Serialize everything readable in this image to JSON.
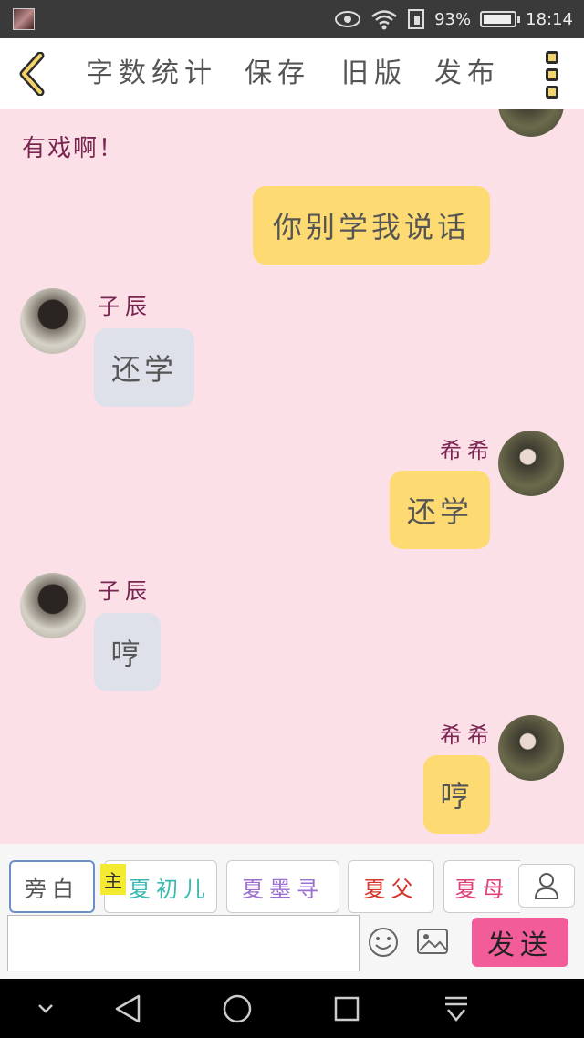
{
  "status_bar": {
    "battery": "93%",
    "time": "18:14",
    "battery_level": 0.93
  },
  "toolbar": {
    "items": [
      "字数统计",
      "保存",
      "旧版",
      "发布"
    ]
  },
  "chat": {
    "narration": "有戏啊！",
    "messages": [
      {
        "side": "me",
        "name": "",
        "text": "你别学我说话"
      },
      {
        "side": "other",
        "name": "子辰",
        "text": "还学"
      },
      {
        "side": "me",
        "name": "希希",
        "text": "还学"
      },
      {
        "side": "other",
        "name": "子辰",
        "text": "哼"
      },
      {
        "side": "me",
        "name": "希希",
        "text": "哼"
      }
    ]
  },
  "roles": {
    "main_tag": "主",
    "items": [
      {
        "label": "旁白",
        "color": "#555555"
      },
      {
        "label": "夏初儿",
        "color": "#3bb8b0"
      },
      {
        "label": "夏墨寻",
        "color": "#9a6fd0"
      },
      {
        "label": "夏父",
        "color": "#d9342b"
      },
      {
        "label": "夏母",
        "color": "#e0407a"
      }
    ]
  },
  "input": {
    "placeholder": "",
    "send_label": "发送"
  },
  "colors": {
    "background": "#fbe0e8",
    "my_bubble": "#fddb72",
    "other_bubble": "#dfe1ea",
    "send_button": "#f25c99",
    "name_color": "#7a2450"
  }
}
